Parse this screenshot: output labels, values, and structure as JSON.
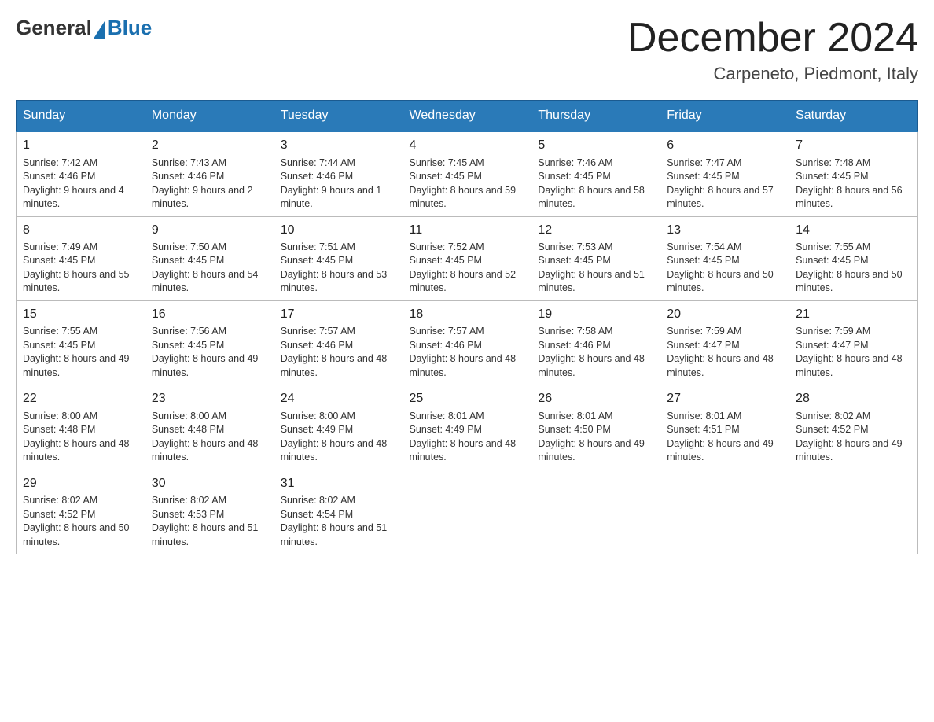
{
  "logo": {
    "general": "General",
    "blue": "Blue"
  },
  "title": "December 2024",
  "location": "Carpeneto, Piedmont, Italy",
  "days_of_week": [
    "Sunday",
    "Monday",
    "Tuesday",
    "Wednesday",
    "Thursday",
    "Friday",
    "Saturday"
  ],
  "weeks": [
    [
      {
        "day": "1",
        "sunrise": "7:42 AM",
        "sunset": "4:46 PM",
        "daylight": "9 hours and 4 minutes."
      },
      {
        "day": "2",
        "sunrise": "7:43 AM",
        "sunset": "4:46 PM",
        "daylight": "9 hours and 2 minutes."
      },
      {
        "day": "3",
        "sunrise": "7:44 AM",
        "sunset": "4:46 PM",
        "daylight": "9 hours and 1 minute."
      },
      {
        "day": "4",
        "sunrise": "7:45 AM",
        "sunset": "4:45 PM",
        "daylight": "8 hours and 59 minutes."
      },
      {
        "day": "5",
        "sunrise": "7:46 AM",
        "sunset": "4:45 PM",
        "daylight": "8 hours and 58 minutes."
      },
      {
        "day": "6",
        "sunrise": "7:47 AM",
        "sunset": "4:45 PM",
        "daylight": "8 hours and 57 minutes."
      },
      {
        "day": "7",
        "sunrise": "7:48 AM",
        "sunset": "4:45 PM",
        "daylight": "8 hours and 56 minutes."
      }
    ],
    [
      {
        "day": "8",
        "sunrise": "7:49 AM",
        "sunset": "4:45 PM",
        "daylight": "8 hours and 55 minutes."
      },
      {
        "day": "9",
        "sunrise": "7:50 AM",
        "sunset": "4:45 PM",
        "daylight": "8 hours and 54 minutes."
      },
      {
        "day": "10",
        "sunrise": "7:51 AM",
        "sunset": "4:45 PM",
        "daylight": "8 hours and 53 minutes."
      },
      {
        "day": "11",
        "sunrise": "7:52 AM",
        "sunset": "4:45 PM",
        "daylight": "8 hours and 52 minutes."
      },
      {
        "day": "12",
        "sunrise": "7:53 AM",
        "sunset": "4:45 PM",
        "daylight": "8 hours and 51 minutes."
      },
      {
        "day": "13",
        "sunrise": "7:54 AM",
        "sunset": "4:45 PM",
        "daylight": "8 hours and 50 minutes."
      },
      {
        "day": "14",
        "sunrise": "7:55 AM",
        "sunset": "4:45 PM",
        "daylight": "8 hours and 50 minutes."
      }
    ],
    [
      {
        "day": "15",
        "sunrise": "7:55 AM",
        "sunset": "4:45 PM",
        "daylight": "8 hours and 49 minutes."
      },
      {
        "day": "16",
        "sunrise": "7:56 AM",
        "sunset": "4:45 PM",
        "daylight": "8 hours and 49 minutes."
      },
      {
        "day": "17",
        "sunrise": "7:57 AM",
        "sunset": "4:46 PM",
        "daylight": "8 hours and 48 minutes."
      },
      {
        "day": "18",
        "sunrise": "7:57 AM",
        "sunset": "4:46 PM",
        "daylight": "8 hours and 48 minutes."
      },
      {
        "day": "19",
        "sunrise": "7:58 AM",
        "sunset": "4:46 PM",
        "daylight": "8 hours and 48 minutes."
      },
      {
        "day": "20",
        "sunrise": "7:59 AM",
        "sunset": "4:47 PM",
        "daylight": "8 hours and 48 minutes."
      },
      {
        "day": "21",
        "sunrise": "7:59 AM",
        "sunset": "4:47 PM",
        "daylight": "8 hours and 48 minutes."
      }
    ],
    [
      {
        "day": "22",
        "sunrise": "8:00 AM",
        "sunset": "4:48 PM",
        "daylight": "8 hours and 48 minutes."
      },
      {
        "day": "23",
        "sunrise": "8:00 AM",
        "sunset": "4:48 PM",
        "daylight": "8 hours and 48 minutes."
      },
      {
        "day": "24",
        "sunrise": "8:00 AM",
        "sunset": "4:49 PM",
        "daylight": "8 hours and 48 minutes."
      },
      {
        "day": "25",
        "sunrise": "8:01 AM",
        "sunset": "4:49 PM",
        "daylight": "8 hours and 48 minutes."
      },
      {
        "day": "26",
        "sunrise": "8:01 AM",
        "sunset": "4:50 PM",
        "daylight": "8 hours and 49 minutes."
      },
      {
        "day": "27",
        "sunrise": "8:01 AM",
        "sunset": "4:51 PM",
        "daylight": "8 hours and 49 minutes."
      },
      {
        "day": "28",
        "sunrise": "8:02 AM",
        "sunset": "4:52 PM",
        "daylight": "8 hours and 49 minutes."
      }
    ],
    [
      {
        "day": "29",
        "sunrise": "8:02 AM",
        "sunset": "4:52 PM",
        "daylight": "8 hours and 50 minutes."
      },
      {
        "day": "30",
        "sunrise": "8:02 AM",
        "sunset": "4:53 PM",
        "daylight": "8 hours and 51 minutes."
      },
      {
        "day": "31",
        "sunrise": "8:02 AM",
        "sunset": "4:54 PM",
        "daylight": "8 hours and 51 minutes."
      },
      null,
      null,
      null,
      null
    ]
  ]
}
